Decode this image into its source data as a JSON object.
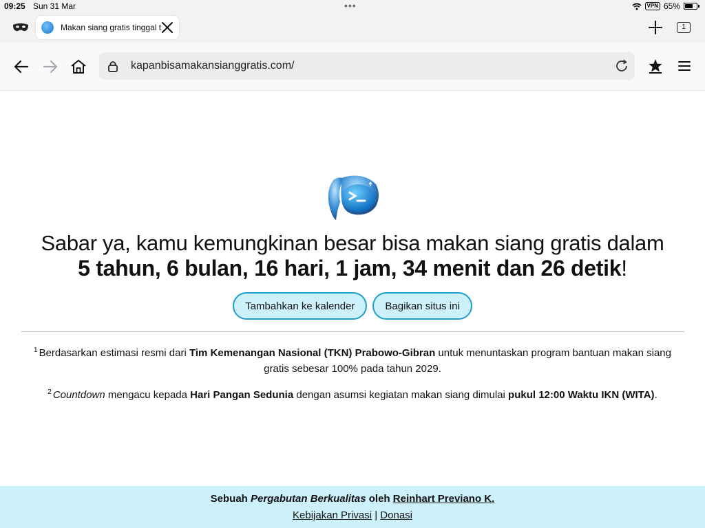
{
  "status_bar": {
    "time": "09:25",
    "date": "Sun 31 Mar",
    "vpn": "VPN",
    "battery": "65%"
  },
  "tabs": {
    "active_title": "Makan siang gratis tinggal t",
    "count": "1"
  },
  "toolbar": {
    "url": "kapanbisamakansianggratis.com/"
  },
  "main": {
    "headline": "Sabar ya, kamu kemungkinan besar bisa makan siang gratis dalam",
    "countdown": "5 tahun, 6 bulan, 16 hari, 1 jam, 34 menit dan 26 detik",
    "countdown_end": "!",
    "buttons": {
      "calendar": "Tambahkan ke kalender",
      "share": "Bagikan situs ini"
    },
    "note1": {
      "marker": "1",
      "t1": "Berdasarkan estimasi resmi dari ",
      "b1": "Tim Kemenangan Nasional (TKN) Prabowo-Gibran",
      "t2": " untuk menuntaskan program bantuan makan siang gratis sebesar 100% pada tahun 2029."
    },
    "note2": {
      "marker": "2",
      "i1": "Countdown",
      "t1": " mengacu kepada ",
      "b1": "Hari Pangan Sedunia",
      "t2": " dengan asumsi kegiatan makan siang dimulai ",
      "b2": "pukul 12:00 Waktu IKN (WITA)",
      "t3": "."
    }
  },
  "footer": {
    "t1": "Sebuah ",
    "i1": "Pergabutan Berkualitas",
    "t2": " oleh ",
    "author": "Reinhart Previano K.",
    "privacy": "Kebijakan Privasi",
    "sep": " | ",
    "donate": "Donasi"
  },
  "colors": {
    "accent": "#1f9ec9",
    "pill_bg": "#cdf1fb",
    "footer_bg": "#cdf1fb"
  }
}
